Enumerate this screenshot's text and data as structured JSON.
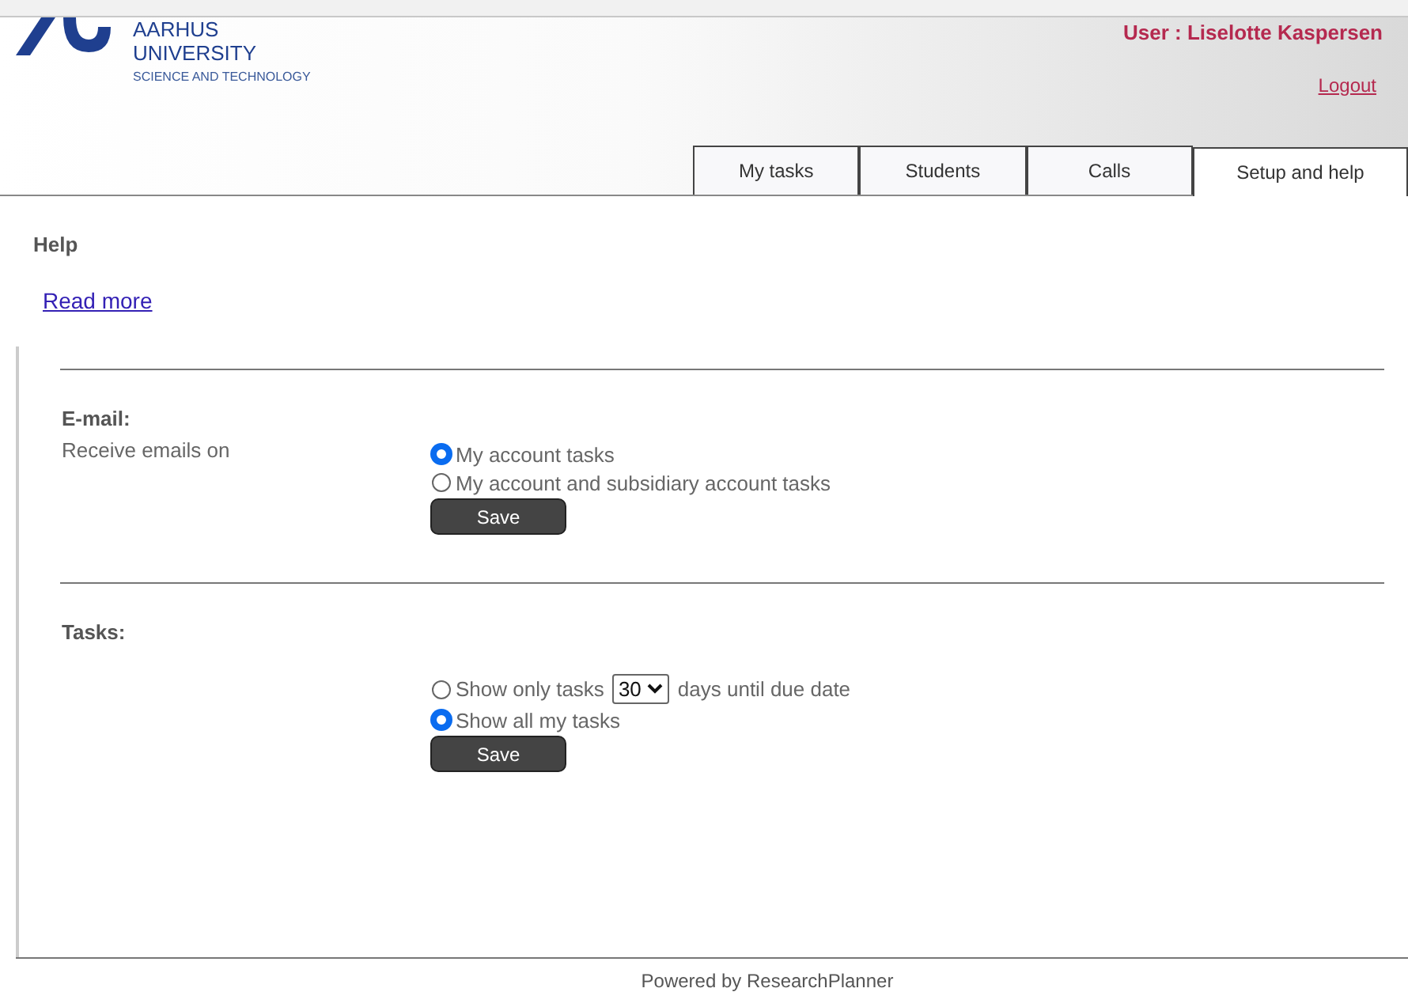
{
  "logo": {
    "name_line_1": "AARHUS",
    "name_line_2": "UNIVERSITY",
    "subtitle": "SCIENCE AND TECHNOLOGY"
  },
  "user": "User : Liselotte Kaspersen",
  "logout": "Logout",
  "tabs": [
    {
      "label": "My tasks",
      "selected": false
    },
    {
      "label": "Students",
      "selected": false
    },
    {
      "label": "Calls",
      "selected": false
    },
    {
      "label": "Setup and help",
      "selected": true
    }
  ],
  "help": {
    "title": "Help",
    "link": "Read more"
  },
  "sections": [
    {
      "title": "E-mail:",
      "label": "Receive emails on",
      "options": [
        {
          "kind": "plain",
          "selected": true,
          "label": "My account tasks"
        },
        {
          "kind": "plain",
          "selected": false,
          "label": "My account and subsidiary account tasks"
        }
      ],
      "button": "Save"
    },
    {
      "title": "Tasks:",
      "options": [
        {
          "kind": "select",
          "selected": false,
          "label": "Show only tasks",
          "select_value": "30",
          "after": "days until due date"
        },
        {
          "kind": "plain",
          "selected": true,
          "label": "Show all my tasks"
        }
      ],
      "button": "Save"
    }
  ],
  "footer": "Powered by ResearchPlanner"
}
